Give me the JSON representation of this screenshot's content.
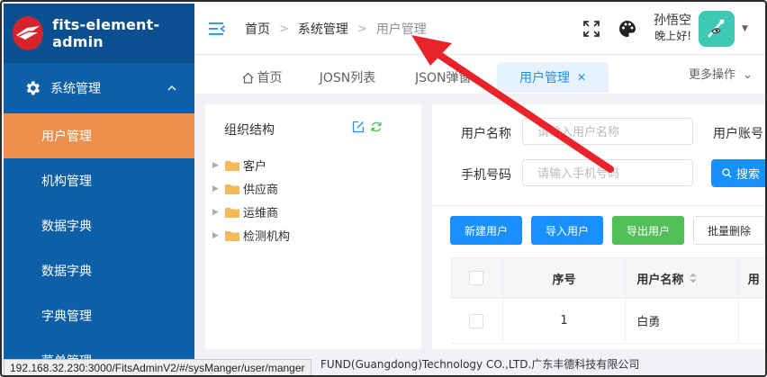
{
  "app": {
    "logo_text": "fits-element-admin",
    "brand_color": "#d6242c"
  },
  "sidebar": {
    "parent": {
      "label": "系统管理",
      "icon": "gear-icon"
    },
    "items": [
      {
        "label": "用户管理",
        "active": true
      },
      {
        "label": "机构管理"
      },
      {
        "label": "数据字典"
      },
      {
        "label": "数据字典"
      },
      {
        "label": "字典管理"
      },
      {
        "label": "菜单管理"
      }
    ]
  },
  "header": {
    "breadcrumbs": [
      "首页",
      "系统管理",
      "用户管理"
    ],
    "user_name": "孙悟空",
    "greeting": "晚上好!"
  },
  "tabs": {
    "items": [
      "首页",
      "JOSN列表",
      "JSON弹窗",
      "用户管理"
    ],
    "active": "用户管理",
    "more_label": "更多操作"
  },
  "org": {
    "title": "组织结构",
    "nodes": [
      "客户",
      "供应商",
      "运维商",
      "检测机构"
    ]
  },
  "search": {
    "username_label": "用户名称",
    "username_placeholder": "请输入用户名称",
    "account_label": "用户账号",
    "phone_label": "手机号码",
    "phone_placeholder": "请输入手机号码",
    "search_label": "搜索"
  },
  "toolbar": {
    "new_label": "新建用户",
    "import_label": "导入用户",
    "export_label": "导出用户",
    "batch_delete_label": "批量删除"
  },
  "table": {
    "headers": [
      "序号",
      "用户名称",
      "用"
    ],
    "rows": [
      {
        "no": "1",
        "name": "白勇"
      }
    ]
  },
  "footer": {
    "text": "FUND(Guangdong)Technology CO.,LTD.广东丰德科技有限公司"
  },
  "status_url": "192.168.32.230:3000/FitsAdminV2/#/sysManger/user/manger",
  "colors": {
    "sidebar": "#0d5fa8",
    "active_menu": "#ee8f4c",
    "primary": "#1890ff",
    "success": "#52be58",
    "annotation_arrow": "#e8232a"
  }
}
